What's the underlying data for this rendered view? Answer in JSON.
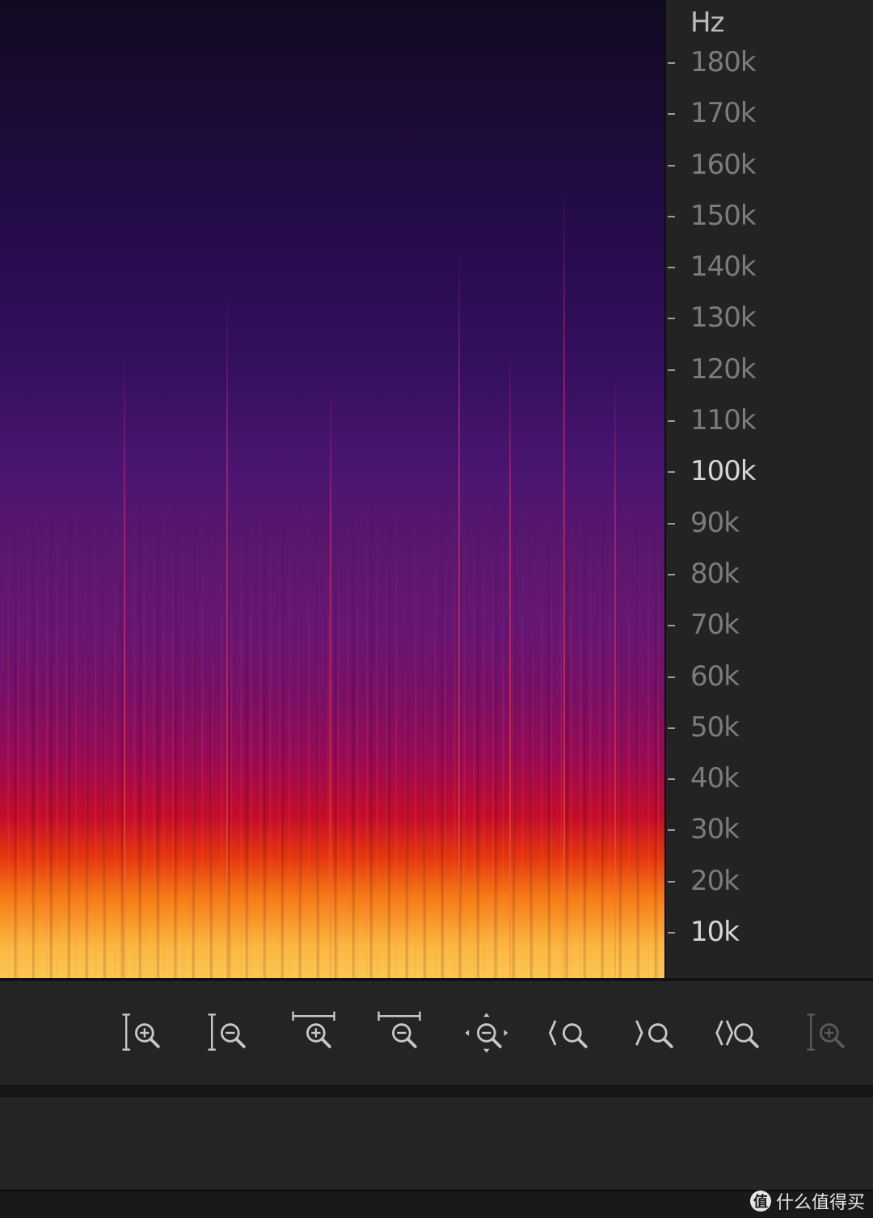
{
  "axis": {
    "unit": "Hz",
    "ticks": [
      {
        "label": "180k",
        "value": 180000,
        "bright": false
      },
      {
        "label": "170k",
        "value": 170000,
        "bright": false
      },
      {
        "label": "160k",
        "value": 160000,
        "bright": false
      },
      {
        "label": "150k",
        "value": 150000,
        "bright": false
      },
      {
        "label": "140k",
        "value": 140000,
        "bright": false
      },
      {
        "label": "130k",
        "value": 130000,
        "bright": false
      },
      {
        "label": "120k",
        "value": 120000,
        "bright": false
      },
      {
        "label": "110k",
        "value": 110000,
        "bright": false
      },
      {
        "label": "100k",
        "value": 100000,
        "bright": true
      },
      {
        "label": "90k",
        "value": 90000,
        "bright": false
      },
      {
        "label": "80k",
        "value": 80000,
        "bright": false
      },
      {
        "label": "70k",
        "value": 70000,
        "bright": false
      },
      {
        "label": "60k",
        "value": 60000,
        "bright": false
      },
      {
        "label": "50k",
        "value": 50000,
        "bright": false
      },
      {
        "label": "40k",
        "value": 40000,
        "bright": false
      },
      {
        "label": "30k",
        "value": 30000,
        "bright": false
      },
      {
        "label": "20k",
        "value": 20000,
        "bright": false
      },
      {
        "label": "10k",
        "value": 10000,
        "bright": true
      }
    ]
  },
  "toolbar": {
    "buttons": [
      {
        "name": "zoom-in-amplitude-button",
        "icon": "zoom-in-amplitude-icon",
        "enabled": true
      },
      {
        "name": "zoom-out-amplitude-button",
        "icon": "zoom-out-amplitude-icon",
        "enabled": true
      },
      {
        "name": "zoom-in-time-button",
        "icon": "zoom-in-time-icon",
        "enabled": true
      },
      {
        "name": "zoom-out-time-button",
        "icon": "zoom-out-time-icon",
        "enabled": true
      },
      {
        "name": "zoom-out-full-button",
        "icon": "zoom-out-full-icon",
        "enabled": true
      },
      {
        "name": "zoom-to-selection-in-button",
        "icon": "zoom-selection-in-icon",
        "enabled": true
      },
      {
        "name": "zoom-to-selection-out-button",
        "icon": "zoom-selection-out-icon",
        "enabled": true
      },
      {
        "name": "zoom-to-selection-button",
        "icon": "zoom-selection-icon",
        "enabled": true
      },
      {
        "name": "zoom-in-disabled-button",
        "icon": "zoom-in-amplitude-icon",
        "enabled": false
      }
    ]
  },
  "colors": {
    "spectrogram_top": "#120a22",
    "spectrogram_mid": "#671572",
    "spectrogram_hot": "#e5350f",
    "spectrogram_base": "#fdc653",
    "panel": "#232323",
    "icon": "#c8c8c8",
    "icon_disabled": "#5a5a5a"
  },
  "watermark": {
    "logo": "值",
    "text": "什么值得买"
  }
}
